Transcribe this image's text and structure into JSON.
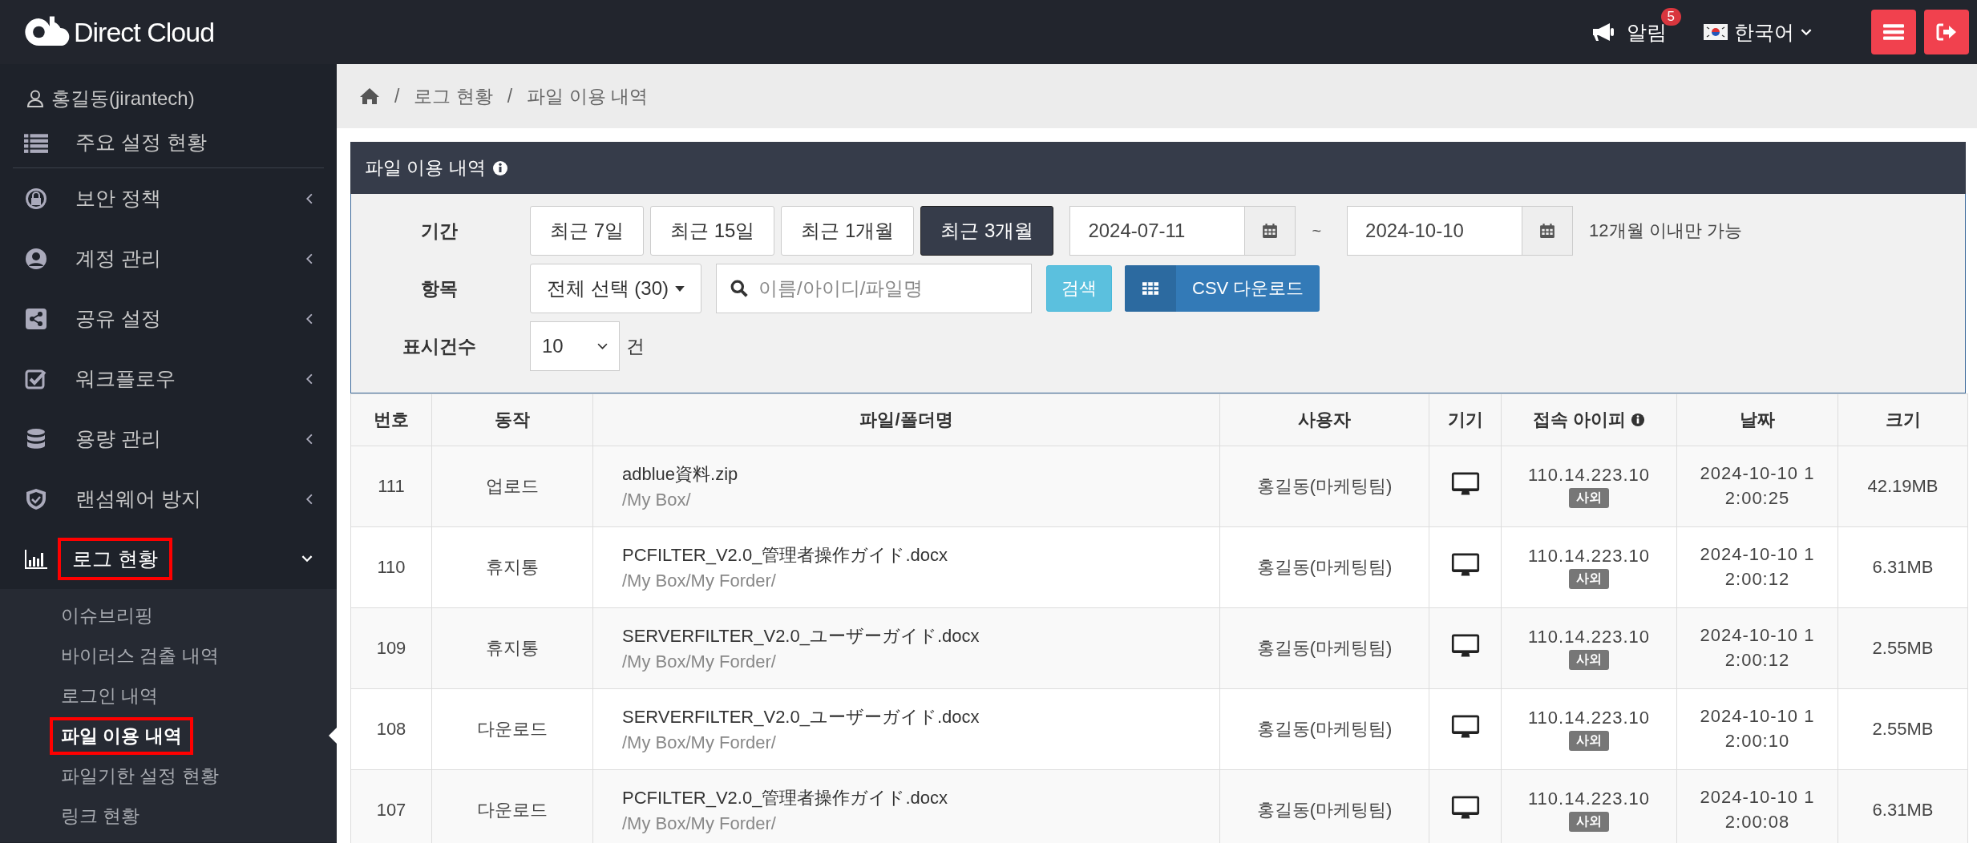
{
  "header": {
    "logo_text": "Direct Cloud",
    "notification": {
      "label": "알림",
      "count": "5"
    },
    "language": {
      "label": "한국어"
    }
  },
  "user": {
    "name": "홍길동(jirantech)"
  },
  "sidebar": {
    "items": [
      {
        "label": "주요 설정 현황",
        "kind": "link",
        "highlighted": false
      },
      {
        "label": "보안 정책",
        "kind": "menu",
        "expanded": false,
        "highlighted": false
      },
      {
        "label": "계정 관리",
        "kind": "menu",
        "expanded": false,
        "highlighted": false
      },
      {
        "label": "공유 설정",
        "kind": "menu",
        "expanded": false,
        "highlighted": false
      },
      {
        "label": "워크플로우",
        "kind": "menu",
        "expanded": false,
        "highlighted": false
      },
      {
        "label": "용량 관리",
        "kind": "menu",
        "expanded": false,
        "highlighted": false
      },
      {
        "label": "랜섬웨어 방지",
        "kind": "menu",
        "expanded": false,
        "highlighted": false
      },
      {
        "label": "로그 현황",
        "kind": "menu",
        "expanded": true,
        "highlighted": true,
        "children": [
          {
            "label": "이슈브리핑",
            "selected": false,
            "highlighted": false
          },
          {
            "label": "바이러스 검출 내역",
            "selected": false,
            "highlighted": false
          },
          {
            "label": "로그인 내역",
            "selected": false,
            "highlighted": false
          },
          {
            "label": "파일 이용 내역",
            "selected": true,
            "highlighted": true
          },
          {
            "label": "파일기한 설정 현황",
            "selected": false,
            "highlighted": false
          },
          {
            "label": "링크 현황",
            "selected": false,
            "highlighted": false
          }
        ]
      }
    ]
  },
  "breadcrumb": [
    {
      "separator": "/",
      "label": "로그 현황"
    },
    {
      "separator": "/",
      "label": "파일 이용 내역"
    }
  ],
  "panel": {
    "title": "파일 이용 내역"
  },
  "filters": {
    "period_label": "기간",
    "periods": [
      {
        "label": "최근 7일",
        "selected": false
      },
      {
        "label": "최근 15일",
        "selected": false
      },
      {
        "label": "최근 1개월",
        "selected": false
      },
      {
        "label": "최근 3개월",
        "selected": true
      }
    ],
    "start_date": "2024-07-11",
    "separator": "~",
    "end_date": "2024-10-10",
    "note": "12개월 이내만 가능",
    "item_label": "항목",
    "item_select": "전체 선택 (30)",
    "search": {
      "placeholder": "이름/아이디/파일명"
    },
    "search_button": "검색",
    "csv_button": "CSV 다운로드",
    "count_label": "표시건수",
    "count_select": "10",
    "count_unit": "건"
  },
  "table": {
    "columns": [
      {
        "label": "번호",
        "info": false
      },
      {
        "label": "동작",
        "info": false
      },
      {
        "label": "파일/폴더명",
        "info": false
      },
      {
        "label": "사용자",
        "info": false
      },
      {
        "label": "기기",
        "info": false
      },
      {
        "label": "접속 아이피",
        "info": true
      },
      {
        "label": "날짜",
        "info": false
      },
      {
        "label": "크기",
        "info": false
      }
    ],
    "rows": [
      {
        "no": "111",
        "action": "업로드",
        "file": "adblue資料.zip",
        "path": "/My Box/",
        "user": "홍길동(마케팅팀)",
        "ip": "110.14.223.10",
        "ip_tag": "사외",
        "date": "2024-10-10 12:00:25",
        "size": "42.19MB"
      },
      {
        "no": "110",
        "action": "휴지통",
        "file": "PCFILTER_V2.0_管理者操作ガイド.docx",
        "path": "/My Box/My Forder/",
        "user": "홍길동(마케팅팀)",
        "ip": "110.14.223.10",
        "ip_tag": "사외",
        "date": "2024-10-10 12:00:12",
        "size": "6.31MB"
      },
      {
        "no": "109",
        "action": "휴지통",
        "file": "SERVERFILTER_V2.0_ユーザーガイド.docx",
        "path": "/My Box/My Forder/",
        "user": "홍길동(마케팅팀)",
        "ip": "110.14.223.10",
        "ip_tag": "사외",
        "date": "2024-10-10 12:00:12",
        "size": "2.55MB"
      },
      {
        "no": "108",
        "action": "다운로드",
        "file": "SERVERFILTER_V2.0_ユーザーガイド.docx",
        "path": "/My Box/My Forder/",
        "user": "홍길동(마케팅팀)",
        "ip": "110.14.223.10",
        "ip_tag": "사외",
        "date": "2024-10-10 12:00:10",
        "size": "2.55MB"
      },
      {
        "no": "107",
        "action": "다운로드",
        "file": "PCFILTER_V2.0_管理者操作ガイド.docx",
        "path": "/My Box/My Forder/",
        "user": "홍길동(마케팅팀)",
        "ip": "110.14.223.10",
        "ip_tag": "사외",
        "date": "2024-10-10 12:00:08",
        "size": "6.31MB"
      }
    ]
  }
}
